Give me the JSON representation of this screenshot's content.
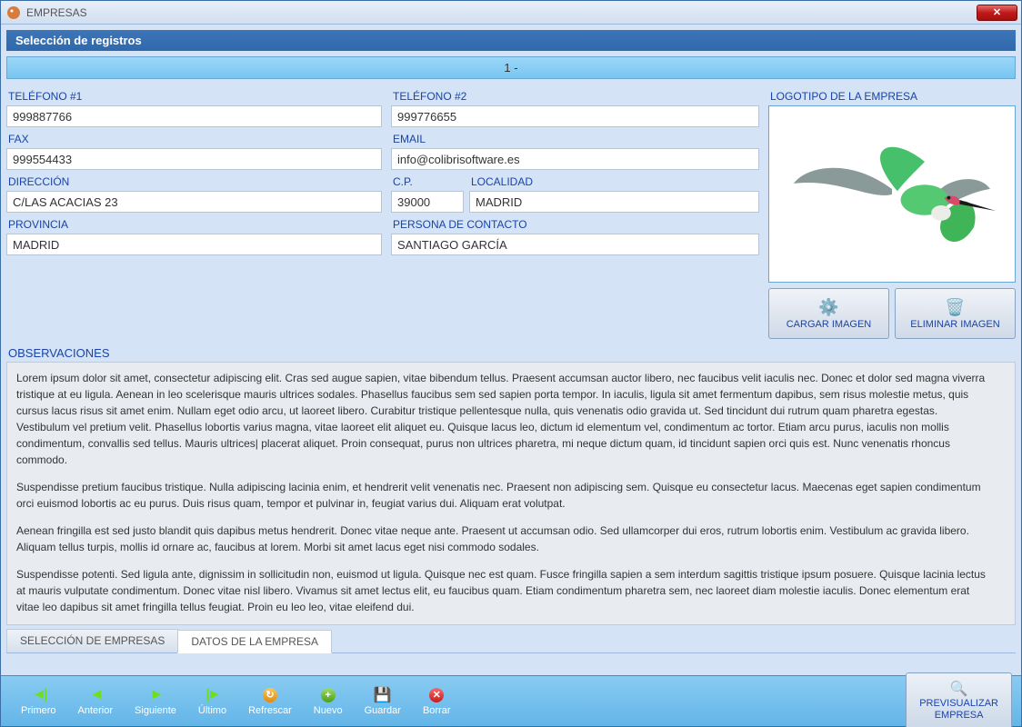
{
  "window": {
    "title": "EMPRESAS"
  },
  "section_header": "Selección de registros",
  "record_selector": "1 -",
  "labels": {
    "telefono1": "TELÉFONO #1",
    "telefono2": "TELÉFONO #2",
    "fax": "FAX",
    "email": "EMAIL",
    "direccion": "DIRECCIÓN",
    "cp": "C.P.",
    "localidad": "LOCALIDAD",
    "provincia": "PROVINCIA",
    "contacto": "PERSONA DE CONTACTO",
    "logotipo": "LOGOTIPO DE LA EMPRESA",
    "observaciones": "OBSERVACIONES"
  },
  "fields": {
    "telefono1": "999887766",
    "telefono2": "999776655",
    "fax": "999554433",
    "email": "info@colibrisoftware.es",
    "direccion": "C/LAS ACACIAS 23",
    "cp": "39000",
    "localidad": "MADRID",
    "provincia": "MADRID",
    "contacto": "SANTIAGO GARCÍA"
  },
  "logo_buttons": {
    "load": "CARGAR IMAGEN",
    "delete": "ELIMINAR IMAGEN"
  },
  "observaciones": {
    "p1": "Lorem ipsum dolor sit amet, consectetur adipiscing elit. Cras sed augue sapien, vitae bibendum tellus. Praesent accumsan auctor libero, nec faucibus velit iaculis nec. Donec et dolor sed magna viverra tristique at eu ligula. Aenean in leo scelerisque mauris ultrices sodales. Phasellus faucibus sem sed sapien porta tempor. In iaculis, ligula sit amet fermentum dapibus, sem risus molestie metus, quis cursus lacus risus sit amet enim. Nullam eget odio arcu, ut laoreet libero. Curabitur tristique pellentesque nulla, quis venenatis odio gravida ut. Sed tincidunt dui rutrum quam pharetra egestas. Vestibulum vel pretium velit. Phasellus lobortis varius magna, vitae laoreet elit aliquet eu. Quisque lacus leo, dictum id elementum vel, condimentum ac tortor. Etiam arcu purus, iaculis non mollis condimentum, convallis sed tellus. Mauris ultrices| placerat aliquet. Proin consequat, purus non ultrices pharetra, mi neque dictum quam, id tincidunt sapien orci quis est. Nunc venenatis rhoncus commodo.",
    "p2": "Suspendisse pretium faucibus tristique. Nulla adipiscing lacinia enim, et hendrerit velit venenatis nec. Praesent non adipiscing sem. Quisque eu consectetur lacus. Maecenas eget sapien condimentum orci euismod lobortis ac eu purus. Duis risus quam, tempor et pulvinar in, feugiat varius dui. Aliquam erat volutpat.",
    "p3": "Aenean fringilla est sed justo blandit quis dapibus metus hendrerit. Donec vitae neque ante. Praesent ut accumsan odio. Sed ullamcorper dui eros, rutrum lobortis enim. Vestibulum ac gravida libero. Aliquam tellus turpis, mollis id ornare ac, faucibus at lorem. Morbi sit amet lacus eget nisi commodo sodales.",
    "p4": "Suspendisse potenti. Sed ligula ante, dignissim in sollicitudin non, euismod ut ligula. Quisque nec est quam. Fusce fringilla sapien a sem interdum sagittis tristique ipsum posuere. Quisque lacinia lectus at mauris vulputate condimentum. Donec vitae nisl libero. Vivamus sit amet lectus elit, eu faucibus quam. Etiam condimentum pharetra sem, nec laoreet diam molestie iaculis. Donec elementum erat vitae leo dapibus sit amet fringilla tellus feugiat. Proin eu leo leo, vitae eleifend dui."
  },
  "tabs": [
    {
      "label": "SELECCIÓN DE EMPRESAS",
      "active": false
    },
    {
      "label": "DATOS DE LA EMPRESA",
      "active": true
    }
  ],
  "nav": {
    "primero": "Primero",
    "anterior": "Anterior",
    "siguiente": "Siguiente",
    "ultimo": "Último",
    "refrescar": "Refrescar",
    "nuevo": "Nuevo",
    "guardar": "Guardar",
    "borrar": "Borrar"
  },
  "preview_btn": {
    "line1": "PREVISUALIZAR",
    "line2": "EMPRESA"
  }
}
